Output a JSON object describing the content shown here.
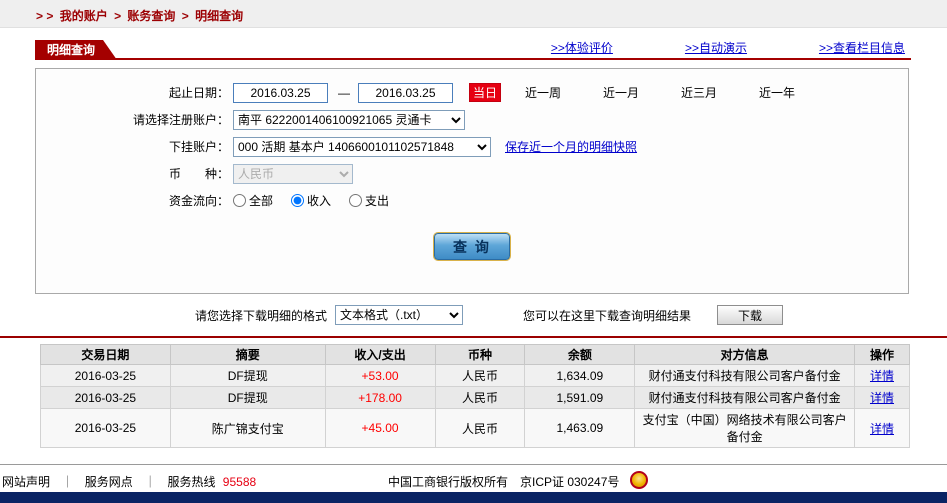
{
  "breadcrumb": {
    "prefix": "> >",
    "sep": ">",
    "items": [
      "我的账户",
      "账务查询",
      "明细查询"
    ]
  },
  "tab": {
    "title": "明细查询",
    "links": [
      ">>体验评价",
      ">>自动演示",
      ">>查看栏目信息"
    ]
  },
  "form": {
    "date_label": "起止日期：",
    "date_from": "2016.03.25",
    "date_sep": "—",
    "date_to": "2016.03.25",
    "today_button": "当日",
    "ranges": [
      "近一周",
      "近一月",
      "近三月",
      "近一年"
    ],
    "account_label": "请选择注册账户：",
    "account_value": "南平 6222001406100921065 灵通卡",
    "sub_account_label": "下挂账户：",
    "sub_account_value": "000 活期 基本户 1406600101102571848",
    "snapshot_link": "保存近一个月的明细快照",
    "currency_label": "币　　种：",
    "currency_value": "人民币",
    "flow_label": "资金流向：",
    "flow_options": [
      {
        "label": "全部",
        "checked": false
      },
      {
        "label": "收入",
        "checked": true
      },
      {
        "label": "支出",
        "checked": false
      }
    ],
    "query_button": "查 询"
  },
  "download": {
    "format_label": "请您选择下载明细的格式",
    "format_value": "文本格式（.txt）",
    "hint": "您可以在这里下载查询明细结果",
    "button": "下载"
  },
  "table": {
    "headers": [
      "交易日期",
      "摘要",
      "收入/支出",
      "币种",
      "余额",
      "对方信息",
      "操作"
    ],
    "rows": [
      {
        "date": "2016-03-25",
        "summary": "DF提现",
        "amount": "+53.00",
        "currency": "人民币",
        "balance": "1,634.09",
        "counterparty": "财付通支付科技有限公司客户备付金",
        "action": "详情"
      },
      {
        "date": "2016-03-25",
        "summary": "DF提现",
        "amount": "+178.00",
        "currency": "人民币",
        "balance": "1,591.09",
        "counterparty": "财付通支付科技有限公司客户备付金",
        "action": "详情"
      },
      {
        "date": "2016-03-25",
        "summary": "陈广锦支付宝",
        "amount": "+45.00",
        "currency": "人民币",
        "balance": "1,463.09",
        "counterparty": "支付宝（中国）网络技术有限公司客户备付金",
        "action": "详情"
      }
    ]
  },
  "footer": {
    "link_statement": "网站声明",
    "link_branches": "服务网点",
    "separator": "｜",
    "hotline_label": "服务热线",
    "hotline_number": "95588",
    "copyright": "中国工商银行版权所有　京ICP证 030247号"
  },
  "colors": {
    "brand_red": "#A40000",
    "link_blue": "#0000CC",
    "amount_red": "#FE0000",
    "accent_red_button": "#E60012"
  }
}
